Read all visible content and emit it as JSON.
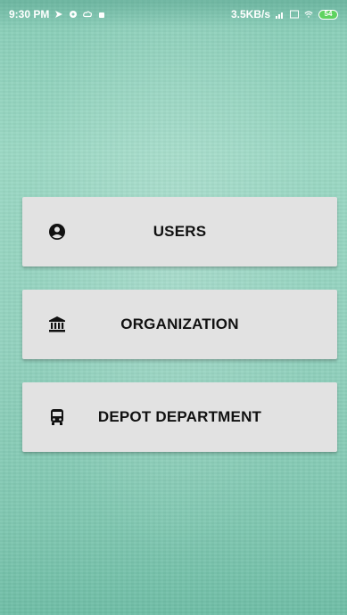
{
  "status_bar": {
    "time": "9:30 PM",
    "speed": "3.5KB/s",
    "battery": "54"
  },
  "menu": {
    "items": [
      {
        "label": "USERS",
        "icon": "user-circle-icon"
      },
      {
        "label": "ORGANIZATION",
        "icon": "bank-icon"
      },
      {
        "label": "DEPOT DEPARTMENT",
        "icon": "bus-icon"
      }
    ]
  },
  "colors": {
    "background": "#93d2bf",
    "button": "#e2e2e2",
    "label": "#111111"
  }
}
